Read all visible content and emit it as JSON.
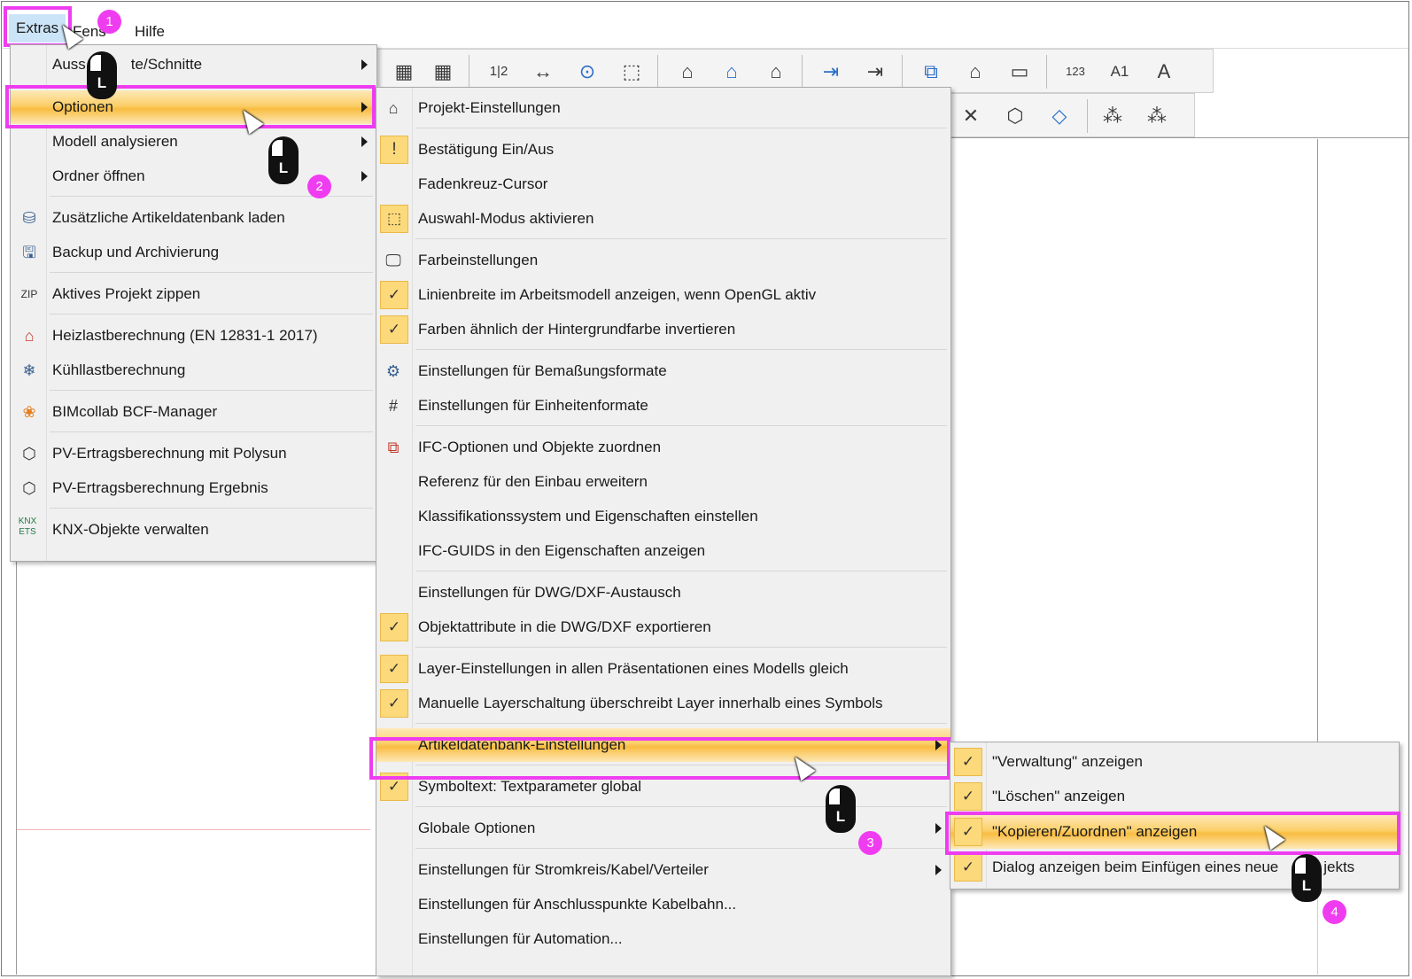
{
  "menubar": {
    "extras": "Extras",
    "fenster": "Fens",
    "hilfe": "Hilfe"
  },
  "badges": [
    "1",
    "2",
    "3",
    "4"
  ],
  "mouse_letter": "L",
  "extras_menu": {
    "items": [
      {
        "label": "Auss   te/Schnitte",
        "submenu": true
      },
      {
        "label": "Optionen",
        "submenu": true
      },
      {
        "label": "Modell analysieren",
        "submenu": true
      },
      {
        "label": "Ordner öffnen",
        "submenu": true
      },
      {
        "label": "Zusätzliche Artikeldatenbank laden",
        "icon": "database-add-icon"
      },
      {
        "label": "Backup und Archivierung",
        "icon": "save-backup-icon"
      },
      {
        "label": "Aktives Projekt zippen",
        "icon": "zip-icon"
      },
      {
        "label": "Heizlastberechnung (EN 12831-1 2017)",
        "icon": "heating-load-icon"
      },
      {
        "label": "Kühllastberechnung",
        "icon": "cooling-load-icon"
      },
      {
        "label": "BIMcollab BCF-Manager",
        "icon": "bimcollab-icon"
      },
      {
        "label": "PV-Ertragsberechnung mit Polysun",
        "icon": "polysun-icon"
      },
      {
        "label": "PV-Ertragsberechnung Ergebnis",
        "icon": "polysun-result-icon"
      },
      {
        "label": "KNX-Objekte verwalten",
        "icon": "knx-ets-icon"
      }
    ]
  },
  "optionen_menu": {
    "items": [
      {
        "label": "Projekt-Einstellungen"
      },
      {
        "label": "Bestätigung Ein/Aus"
      },
      {
        "label": "Fadenkreuz-Cursor"
      },
      {
        "label": "Auswahl-Modus aktivieren"
      },
      {
        "label": "Farbeinstellungen"
      },
      {
        "label": "Linienbreite im Arbeitsmodell anzeigen, wenn OpenGL aktiv"
      },
      {
        "label": "Farben ähnlich der Hintergrundfarbe invertieren"
      },
      {
        "label": "Einstellungen für Bemaßungsformate"
      },
      {
        "label": "Einstellungen für Einheitenformate"
      },
      {
        "label": "IFC-Optionen und Objekte zuordnen"
      },
      {
        "label": "Referenz für den Einbau erweitern"
      },
      {
        "label": "Klassifikationssystem und Eigenschaften einstellen"
      },
      {
        "label": "IFC-GUIDS in den Eigenschaften anzeigen"
      },
      {
        "label": "Einstellungen für DWG/DXF-Austausch"
      },
      {
        "label": "Objektattribute in die DWG/DXF exportieren"
      },
      {
        "label": "Layer-Einstellungen in allen Präsentationen eines Modells gleich"
      },
      {
        "label": "Manuelle Layerschaltung überschreibt Layer innerhalb eines Symbols"
      },
      {
        "label": "Artikeldatenbank-Einstellungen"
      },
      {
        "label": "Symboltext: Textparameter global"
      },
      {
        "label": "Globale Optionen"
      },
      {
        "label": "Einstellungen für Stromkreis/Kabel/Verteiler"
      },
      {
        "label": "Einstellungen für Anschlusspunkte Kabelbahn..."
      },
      {
        "label": "Einstellungen für Automation..."
      }
    ]
  },
  "artikel_menu": {
    "items": [
      {
        "label": "\"Verwaltung\" anzeigen"
      },
      {
        "label": "\"Löschen\" anzeigen"
      },
      {
        "label": "\"Kopieren/Zuordnen\" anzeigen"
      },
      {
        "label": "Dialog anzeigen beim Einfügen eines neue   jekts"
      }
    ]
  },
  "check_mark": "✓",
  "toolbar_glyphs": [
    "▦",
    "▦",
    "1|2",
    "↔",
    "⊙",
    "⬚",
    "⌂",
    "⌂",
    "⌂",
    "⇥",
    "⇥",
    "⧉",
    "⌂",
    "▭",
    "123",
    "A1",
    "A"
  ],
  "toolbar2_glyphs": [
    "✕",
    "⬡",
    "◇",
    "⁂",
    "⁂"
  ]
}
